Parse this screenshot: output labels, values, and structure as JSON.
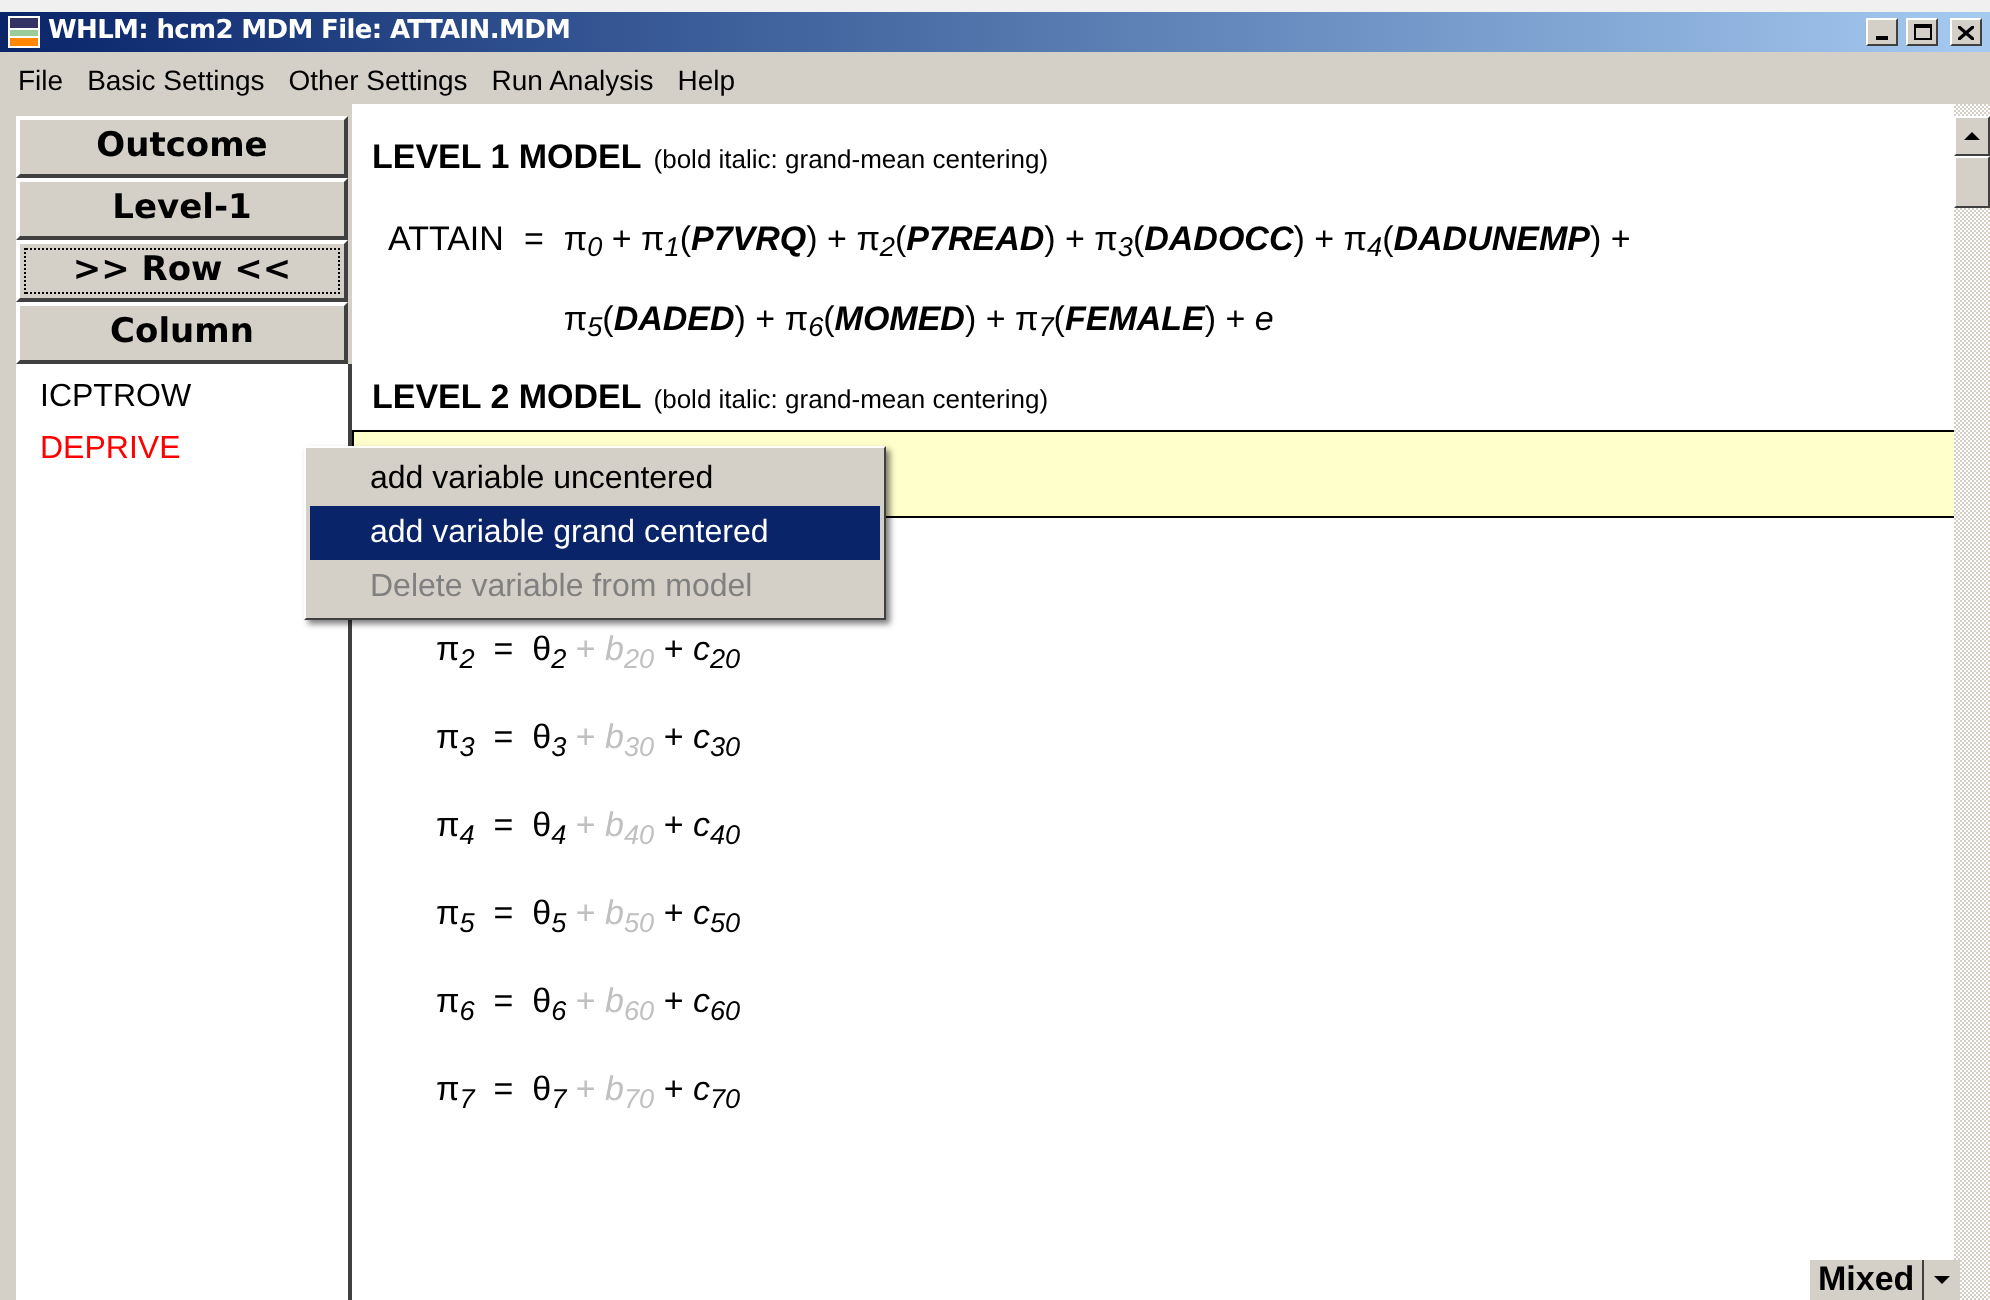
{
  "window": {
    "title": "WHLM: hcm2 MDM File: ATTAIN.MDM"
  },
  "menu": [
    "File",
    "Basic Settings",
    "Other Settings",
    "Run Analysis",
    "Help"
  ],
  "sidebar": {
    "buttons": [
      {
        "label": "Outcome",
        "selected": false
      },
      {
        "label": "Level-1",
        "selected": false
      },
      {
        "label": ">> Row <<",
        "selected": true
      },
      {
        "label": "Column",
        "selected": false
      }
    ],
    "variables": [
      {
        "name": "ICPTROW",
        "color": "#000000"
      },
      {
        "name": "DEPRIVE",
        "color": "#ff0000"
      }
    ]
  },
  "level1": {
    "heading": "LEVEL 1 MODEL",
    "note": "(bold italic: grand-mean centering)",
    "lhs": "ATTAIN",
    "equals": "=",
    "lines": [
      "π$_{0}$ + π$_{1}$(**P7VRQ**) + π$_{2}$(**P7READ**) + π$_{3}$(**DADOCC**) + π$_{4}$(**DADUNEMP**) +",
      "π$_{5}$(**DADED**) + π$_{6}$(**MOMED**) + π$_{7}$(**FEMALE**) + *e*"
    ]
  },
  "level2": {
    "heading": "LEVEL 2 MODEL",
    "note": "(bold italic: grand-mean centering)",
    "rows": [
      {
        "kind": "hidden",
        "selected": true
      },
      {
        "kind": "equation",
        "selected": false,
        "lhs": "π$_{2}$  =  θ$_{2}$",
        "faint": "+ *b*$_{20}$",
        "rest": "+ *c*$_{20}$"
      },
      {
        "kind": "equation",
        "selected": false,
        "lhs": "π$_{3}$  =  θ$_{3}$",
        "faint": "+ *b*$_{30}$",
        "rest": "+ *c*$_{30}$"
      },
      {
        "kind": "equation",
        "selected": false,
        "lhs": "π$_{4}$  =  θ$_{4}$",
        "faint": "+ *b*$_{40}$",
        "rest": "+ *c*$_{40}$"
      },
      {
        "kind": "equation",
        "selected": false,
        "lhs": "π$_{5}$  =  θ$_{5}$",
        "faint": "+ *b*$_{50}$",
        "rest": "+ *c*$_{50}$"
      },
      {
        "kind": "equation",
        "selected": false,
        "lhs": "π$_{6}$  =  θ$_{6}$",
        "faint": "+ *b*$_{60}$",
        "rest": "+ *c*$_{60}$"
      },
      {
        "kind": "equation",
        "selected": false,
        "lhs": "π$_{7}$  =  θ$_{7}$",
        "faint": "+ *b*$_{70}$",
        "rest": "+ *c*$_{70}$"
      }
    ]
  },
  "context_menu": [
    {
      "label": "add variable uncentered",
      "selected": false,
      "disabled": false
    },
    {
      "label": "add variable grand centered",
      "selected": true,
      "disabled": false
    },
    {
      "label": "Delete variable from model",
      "selected": false,
      "disabled": true
    }
  ],
  "mode_dropdown": {
    "value": "Mixed"
  }
}
